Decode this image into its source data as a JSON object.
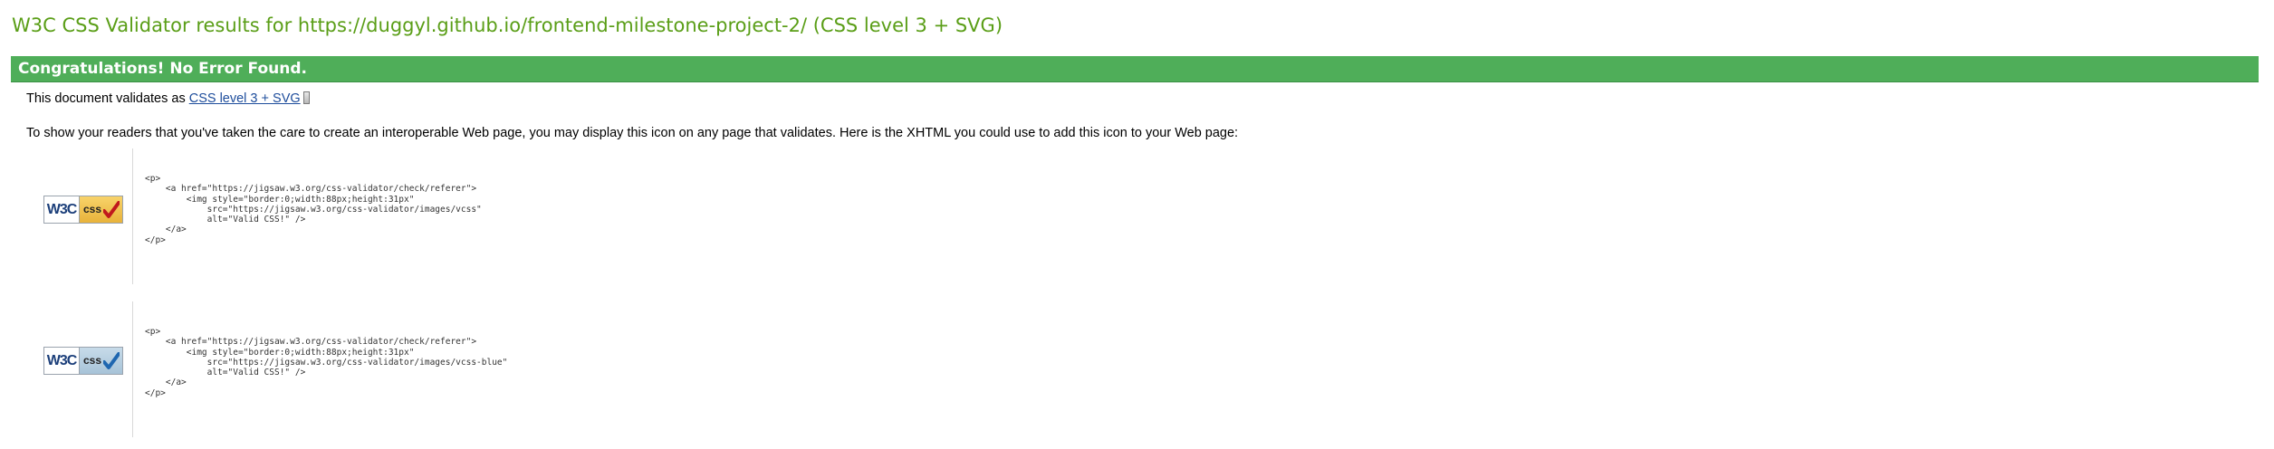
{
  "header": {
    "title": "W3C CSS Validator results for https://duggyl.github.io/frontend-milestone-project-2/ (CSS level 3 + SVG)"
  },
  "banner": {
    "text": "Congratulations! No Error Found."
  },
  "validation": {
    "prefix": "This document validates as ",
    "link_text": "CSS level 3 + SVG",
    "icon": "external-link-icon"
  },
  "info": {
    "text": "To show your readers that you've taken the care to create an interoperable Web page, you may display this icon on any page that validates. Here is the XHTML you could use to add this icon to your Web page:"
  },
  "badges": [
    {
      "variant": "gold",
      "w3c_label": "W3C",
      "css_label": "css",
      "check_icon": "red-checkmark-icon",
      "code": "<p>\n    <a href=\"https://jigsaw.w3.org/css-validator/check/referer\">\n        <img style=\"border:0;width:88px;height:31px\"\n            src=\"https://jigsaw.w3.org/css-validator/images/vcss\"\n            alt=\"Valid CSS!\" />\n    </a>\n</p>"
    },
    {
      "variant": "blue",
      "w3c_label": "W3C",
      "css_label": "css",
      "check_icon": "blue-checkmark-icon",
      "code": "<p>\n    <a href=\"https://jigsaw.w3.org/css-validator/check/referer\">\n        <img style=\"border:0;width:88px;height:31px\"\n            src=\"https://jigsaw.w3.org/css-validator/images/vcss-blue\"\n            alt=\"Valid CSS!\" />\n    </a>\n</p>"
    }
  ],
  "colors": {
    "title": "#5a9e17",
    "banner_bg": "#4fae59",
    "link": "#1e4d9c"
  }
}
